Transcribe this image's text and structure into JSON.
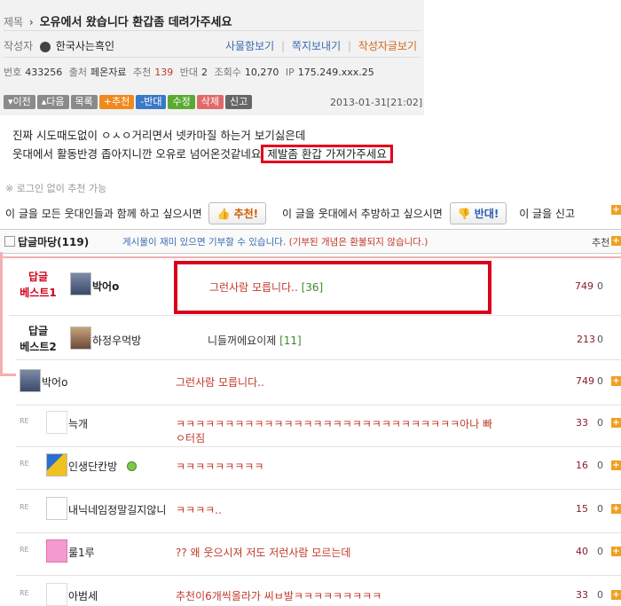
{
  "post": {
    "title_label": "제목",
    "title_bullet": "›",
    "title": "오유에서 왔습니다 환갑좀 데려가주세요",
    "author_label": "작성자",
    "author": "한국사는흑인",
    "links": [
      "사물함보기",
      "쪽지보내기",
      "작성자글보기"
    ],
    "meta": {
      "no_label": "번호",
      "no": "433256",
      "src_label": "출처",
      "src": "페온자료",
      "rec_label": "추천",
      "rec": "139",
      "opp_label": "반대",
      "opp": "2",
      "views_label": "조회수",
      "views": "10,270",
      "ip_label": "IP",
      "ip": "175.249.xxx.25"
    },
    "nav_buttons": [
      {
        "label": "▾이전",
        "color": "#8a8a8a"
      },
      {
        "label": "▴다음",
        "color": "#8a8a8a"
      },
      {
        "label": "목록",
        "color": "#8a8a8a"
      },
      {
        "label": "+추천",
        "color": "#f08a1c"
      },
      {
        "label": "-반대",
        "color": "#3a78c8"
      },
      {
        "label": "수정",
        "color": "#5aaa32"
      },
      {
        "label": "삭제",
        "color": "#e06a6a"
      },
      {
        "label": "신고",
        "color": "#666666"
      }
    ],
    "date": "2013-01-31[21:02]",
    "body_line1": "진짜 시도때도없이 ㅇㅅㅇ거리면서 넷카마질 하는거 보기싫은데",
    "body_line2": "웃대에서 활동반경 좁아지니깐 오유로 넘어온것같네요",
    "body_highlight": "제발좀 환갑 가져가주세요"
  },
  "vote": {
    "login_note": "※ 로그인 없이 추천 가능",
    "up_text": "이 글을 모든 웃대인들과 함께 하고 싶으시면",
    "up_btn": "추천!",
    "down_text": "이 글을 웃대에서 추방하고 싶으시면",
    "down_btn": "반대!",
    "trail_text": "이 글을 신고"
  },
  "comments_header": {
    "title": "답글마당",
    "count": "(119)",
    "note": "게시물이 재미 있으면 기부할 수 있습니다.",
    "note_red": "(기부된 개념은 환불되지 않습니다.)",
    "sort_label": "추천"
  },
  "best": [
    {
      "label1": "답글",
      "label2": "베스트1",
      "nick": "박어o",
      "text": "그런사람 모릅니다..",
      "count": "[36]",
      "score": "749",
      "zero": "0"
    },
    {
      "label1": "답글",
      "label2": "베스트2",
      "nick": "하정우먹방",
      "text": "니들꺼에요이제",
      "count": "[11]",
      "score": "213",
      "zero": "0"
    }
  ],
  "comments": [
    {
      "nick": "박어o",
      "text": "그런사람 모릅니다..",
      "score": "749",
      "zero": "0",
      "reply": false
    },
    {
      "nick": "늑개",
      "text": "ㅋㅋㅋㅋㅋㅋㅋㅋㅋㅋㅋㅋㅋㅋㅋㅋㅋㅋㅋㅋㅋㅋㅋㅋㅋㅋㅋㅋㅋ아나 빠",
      "text2": "ㅇ터짐",
      "score": "33",
      "zero": "0",
      "reply": true
    },
    {
      "nick": "인생단칸방",
      "text": "ㅋㅋㅋㅋㅋㅋㅋㅋㅋ",
      "score": "16",
      "zero": "0",
      "reply": true
    },
    {
      "nick": "내닉네임정말길지않니",
      "text": "ㅋㅋㅋㅋ..",
      "score": "15",
      "zero": "0",
      "reply": true
    },
    {
      "nick": "룰1루",
      "text": "?? 왜 웃으시져 저도 저런사람 모르는데",
      "score": "40",
      "zero": "0",
      "reply": true
    },
    {
      "nick": "아범세",
      "text": "추천이6개씩올라가 씨ㅂ발ㅋㅋㅋㅋㅋㅋㅋㅋㅋ",
      "score": "33",
      "zero": "0",
      "reply": true
    }
  ],
  "re_label": "RE",
  "plus_glyph": "+"
}
